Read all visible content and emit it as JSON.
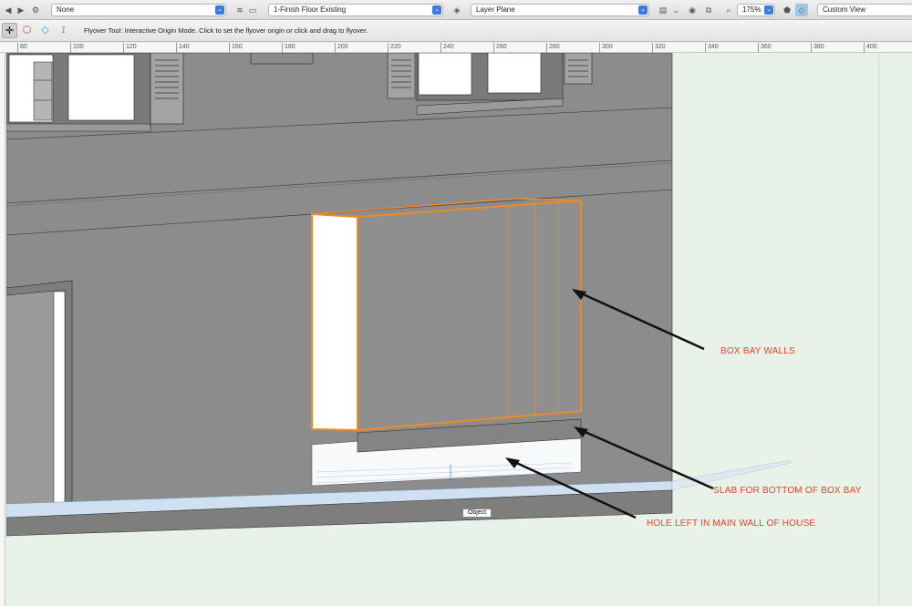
{
  "viewbar": {
    "class_popup": "None",
    "layer_popup": "1-Finish Floor Existing",
    "plane_popup": "Layer Plane",
    "zoom_value": "175%",
    "view_popup": "Custom View"
  },
  "toolbar": {
    "help_text": "Flyover Tool: Interactive Origin Mode. Click to set the flyover origin or click and drag to flyover."
  },
  "ruler": {
    "ticks": [
      "80",
      "100",
      "120",
      "140",
      "160",
      "180",
      "200",
      "220",
      "240",
      "260",
      "280",
      "300",
      "320",
      "340",
      "360",
      "380",
      "400"
    ]
  },
  "drawing": {
    "object_tag": "Object"
  },
  "annotations": {
    "box_bay_walls": "BOX BAY WALLS",
    "slab": "SLAB FOR BOTTOM OF BOX BAY",
    "hole": "HOLE LEFT IN MAIN WALL OF HOUSE"
  },
  "colors": {
    "wall": "#8a8a8a",
    "selection": "#f08a24",
    "annotation": "#e8402a",
    "background": "#e9f2e9"
  }
}
